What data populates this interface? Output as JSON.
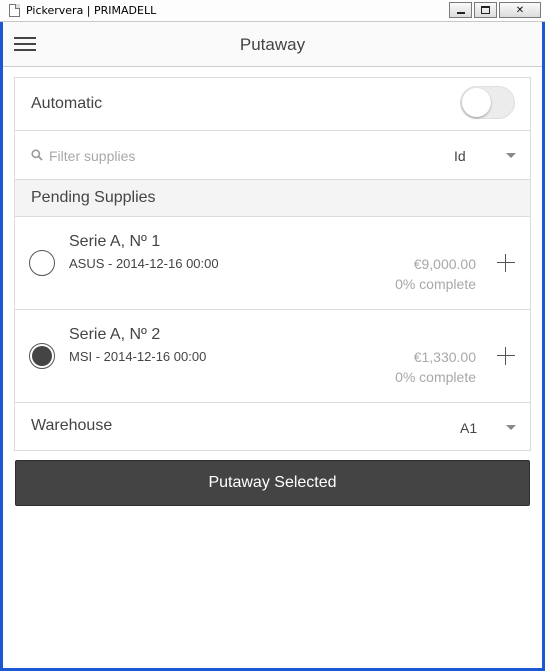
{
  "window": {
    "title": "Pickervera | PRIMADELL",
    "minimize_label": "",
    "maximize_label": "",
    "close_label": "✕"
  },
  "header": {
    "title": "Putaway"
  },
  "automatic": {
    "label": "Automatic",
    "enabled": false
  },
  "filter": {
    "placeholder": "Filter supplies",
    "value": "",
    "sort_by": "Id"
  },
  "pending": {
    "section_title": "Pending Supplies",
    "items": [
      {
        "title": "Serie A, Nº 1",
        "subtitle": "ASUS - 2014-12-16 00:00",
        "amount": "€9,000.00",
        "complete": "0% complete",
        "selected": false
      },
      {
        "title": "Serie A, Nº 2",
        "subtitle": "MSI - 2014-12-16 00:00",
        "amount": "€1,330.00",
        "complete": "0% complete",
        "selected": true
      }
    ]
  },
  "warehouse": {
    "label": "Warehouse",
    "value": "A1"
  },
  "actions": {
    "putaway_label": "Putaway Selected"
  },
  "colors": {
    "window_frame": "#1e57d3",
    "primary_button": "#444444",
    "muted_text": "#a8a8a8",
    "section_bg": "#f4f4f4"
  },
  "icons": {
    "menu": "hamburger-icon",
    "search": "search-icon",
    "add": "plus-icon",
    "dropdown": "chevron-down-icon"
  }
}
